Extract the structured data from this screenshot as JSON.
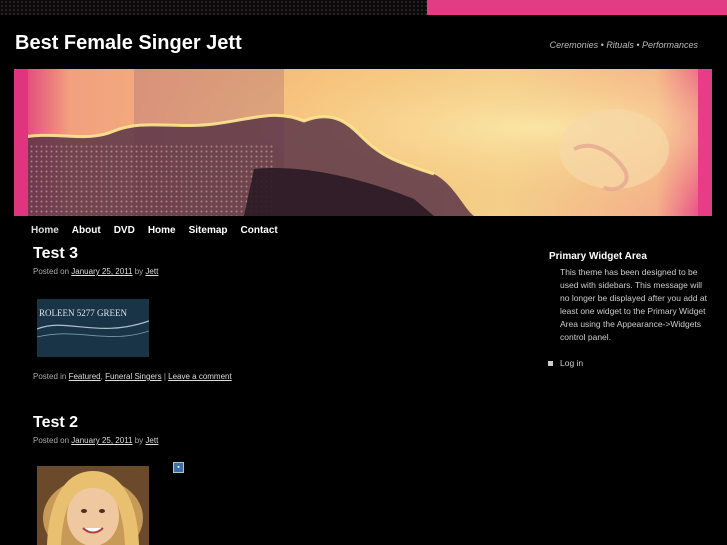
{
  "site": {
    "title": "Best Female Singer Jett",
    "tagline": "Ceremonies • Rituals • Performances"
  },
  "menu": [
    "Home",
    "About",
    "DVD",
    "Home",
    "Sitemap",
    "Contact"
  ],
  "posts": [
    {
      "title": "Test 3",
      "posted_on": "Posted on",
      "date": "January 25, 2011",
      "by": "by",
      "author": "Jett",
      "image_text": "ROLEEN 5277 GREEN",
      "posted_in": "Posted in",
      "categories": [
        "Featured",
        "Funeral Singers"
      ],
      "separator": "|",
      "comment_link": "Leave a comment"
    },
    {
      "title": "Test 2",
      "posted_on": "Posted on",
      "date": "January 25, 2011",
      "by": "by",
      "author": "Jett"
    }
  ],
  "sidebar": {
    "widget_title": "Primary Widget Area",
    "widget_text": "This theme has been designed to be used with sidebars. This message will no longer be displayed after you add at least one widget to the Primary Widget Area using the Appearance->Widgets control panel.",
    "login_label": "Log in"
  },
  "colors": {
    "background": "#000000",
    "accent": "#e23d84"
  }
}
